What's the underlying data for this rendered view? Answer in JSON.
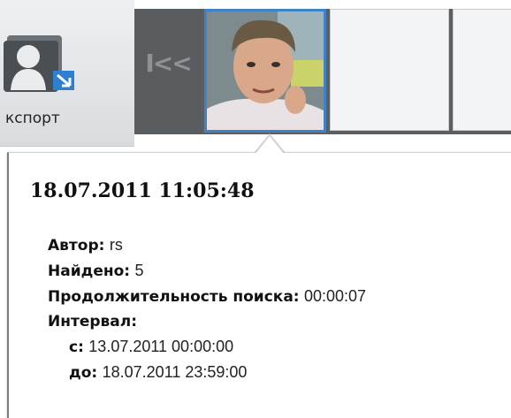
{
  "toolbar": {
    "export_label": "кспорт",
    "nav_first_symbol": "I<<"
  },
  "record": {
    "datetime": "18.07.2011 11:05:48",
    "author_label": "Автор:",
    "author_value": "rs",
    "found_label": "Найдено:",
    "found_value": "5",
    "duration_label": "Продолжительность поиска:",
    "duration_value": "00:00:07",
    "interval_label": "Интервал:",
    "from_label": "с:",
    "from_value": "13.07.2011 00:00:00",
    "to_label": "до:",
    "to_value": "18.07.2011 23:59:00"
  },
  "colors": {
    "selection": "#3e83c9",
    "strip": "#5c5f62"
  }
}
